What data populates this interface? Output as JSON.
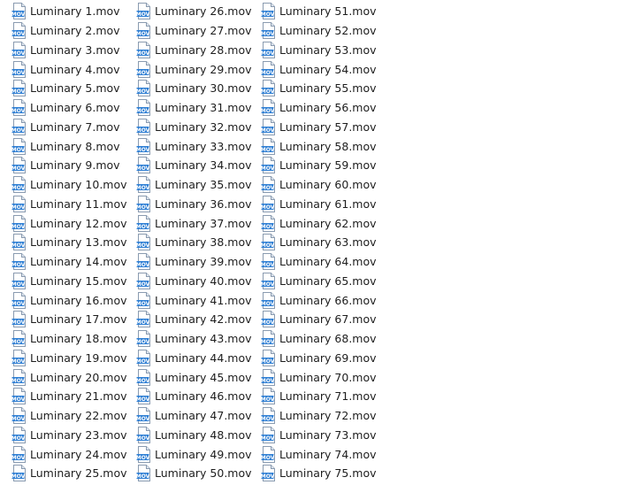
{
  "window": {
    "view": "list"
  },
  "icon": {
    "type": "mov-file-icon",
    "label": "MOV",
    "accent_color": "#2f7fd4"
  },
  "columns": [
    {
      "items": [
        "Luminary 1.mov",
        "Luminary 2.mov",
        "Luminary 3.mov",
        "Luminary 4.mov",
        "Luminary 5.mov",
        "Luminary 6.mov",
        "Luminary 7.mov",
        "Luminary 8.mov",
        "Luminary 9.mov",
        "Luminary 10.mov",
        "Luminary 11.mov",
        "Luminary 12.mov",
        "Luminary 13.mov",
        "Luminary 14.mov",
        "Luminary 15.mov",
        "Luminary 16.mov",
        "Luminary 17.mov",
        "Luminary 18.mov",
        "Luminary 19.mov",
        "Luminary 20.mov",
        "Luminary 21.mov",
        "Luminary 22.mov",
        "Luminary 23.mov",
        "Luminary 24.mov",
        "Luminary 25.mov"
      ]
    },
    {
      "items": [
        "Luminary 26.mov",
        "Luminary 27.mov",
        "Luminary 28.mov",
        "Luminary 29.mov",
        "Luminary 30.mov",
        "Luminary 31.mov",
        "Luminary 32.mov",
        "Luminary 33.mov",
        "Luminary 34.mov",
        "Luminary 35.mov",
        "Luminary 36.mov",
        "Luminary 37.mov",
        "Luminary 38.mov",
        "Luminary 39.mov",
        "Luminary 40.mov",
        "Luminary 41.mov",
        "Luminary 42.mov",
        "Luminary 43.mov",
        "Luminary 44.mov",
        "Luminary 45.mov",
        "Luminary 46.mov",
        "Luminary 47.mov",
        "Luminary 48.mov",
        "Luminary 49.mov",
        "Luminary 50.mov"
      ]
    },
    {
      "items": [
        "Luminary 51.mov",
        "Luminary 52.mov",
        "Luminary 53.mov",
        "Luminary 54.mov",
        "Luminary 55.mov",
        "Luminary 56.mov",
        "Luminary 57.mov",
        "Luminary 58.mov",
        "Luminary 59.mov",
        "Luminary 60.mov",
        "Luminary 61.mov",
        "Luminary 62.mov",
        "Luminary 63.mov",
        "Luminary 64.mov",
        "Luminary 65.mov",
        "Luminary 66.mov",
        "Luminary 67.mov",
        "Luminary 68.mov",
        "Luminary 69.mov",
        "Luminary 70.mov",
        "Luminary 71.mov",
        "Luminary 72.mov",
        "Luminary 73.mov",
        "Luminary 74.mov",
        "Luminary 75.mov"
      ]
    }
  ]
}
